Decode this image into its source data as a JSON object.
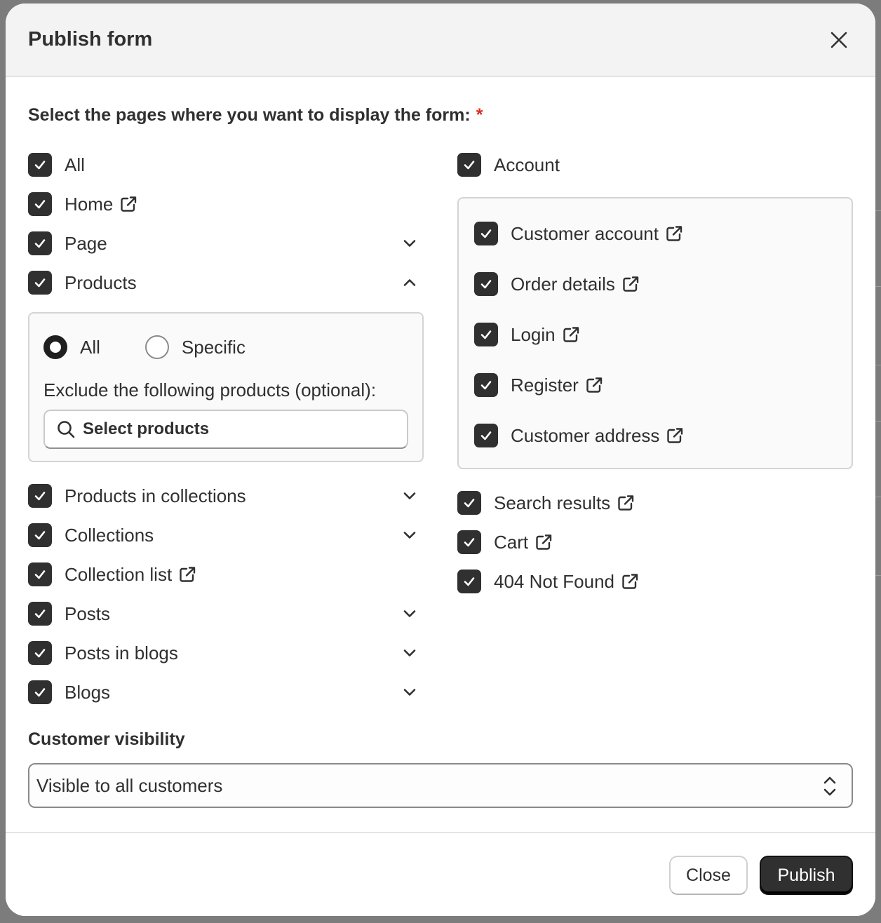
{
  "modal": {
    "title": "Publish form"
  },
  "pages_section": {
    "label": "Select the pages where you want to display the form:",
    "required_mark": "*"
  },
  "left_items_top": [
    {
      "label": "All",
      "checked": true,
      "external": false,
      "chevron": "none"
    },
    {
      "label": "Home",
      "checked": true,
      "external": true,
      "chevron": "none"
    },
    {
      "label": "Page",
      "checked": true,
      "external": false,
      "chevron": "down"
    },
    {
      "label": "Products",
      "checked": true,
      "external": false,
      "chevron": "up"
    }
  ],
  "products_panel": {
    "radio_all": "All",
    "radio_specific": "Specific",
    "selected": "All",
    "exclude_label": "Exclude the following products (optional):",
    "search_label": "Select products"
  },
  "left_items_bottom": [
    {
      "label": "Products in collections",
      "checked": true,
      "external": false,
      "chevron": "down"
    },
    {
      "label": "Collections",
      "checked": true,
      "external": false,
      "chevron": "down"
    },
    {
      "label": "Collection list",
      "checked": true,
      "external": true,
      "chevron": "none"
    },
    {
      "label": "Posts",
      "checked": true,
      "external": false,
      "chevron": "down"
    },
    {
      "label": "Posts in blogs",
      "checked": true,
      "external": false,
      "chevron": "down"
    },
    {
      "label": "Blogs",
      "checked": true,
      "external": false,
      "chevron": "down"
    }
  ],
  "account": {
    "label": "Account",
    "checked": true,
    "items": [
      {
        "label": "Customer account",
        "checked": true
      },
      {
        "label": "Order details",
        "checked": true
      },
      {
        "label": "Login",
        "checked": true
      },
      {
        "label": "Register",
        "checked": true
      },
      {
        "label": "Customer address",
        "checked": true
      }
    ]
  },
  "right_items_bottom": [
    {
      "label": "Search results",
      "checked": true
    },
    {
      "label": "Cart",
      "checked": true
    },
    {
      "label": "404 Not Found",
      "checked": true
    }
  ],
  "visibility": {
    "label": "Customer visibility",
    "value": "Visible to all customers"
  },
  "footer": {
    "close_label": "Close",
    "publish_label": "Publish"
  },
  "colors": {
    "checkbox": "#303030",
    "required": "#e02b1b",
    "publish_bg": "#303030"
  }
}
